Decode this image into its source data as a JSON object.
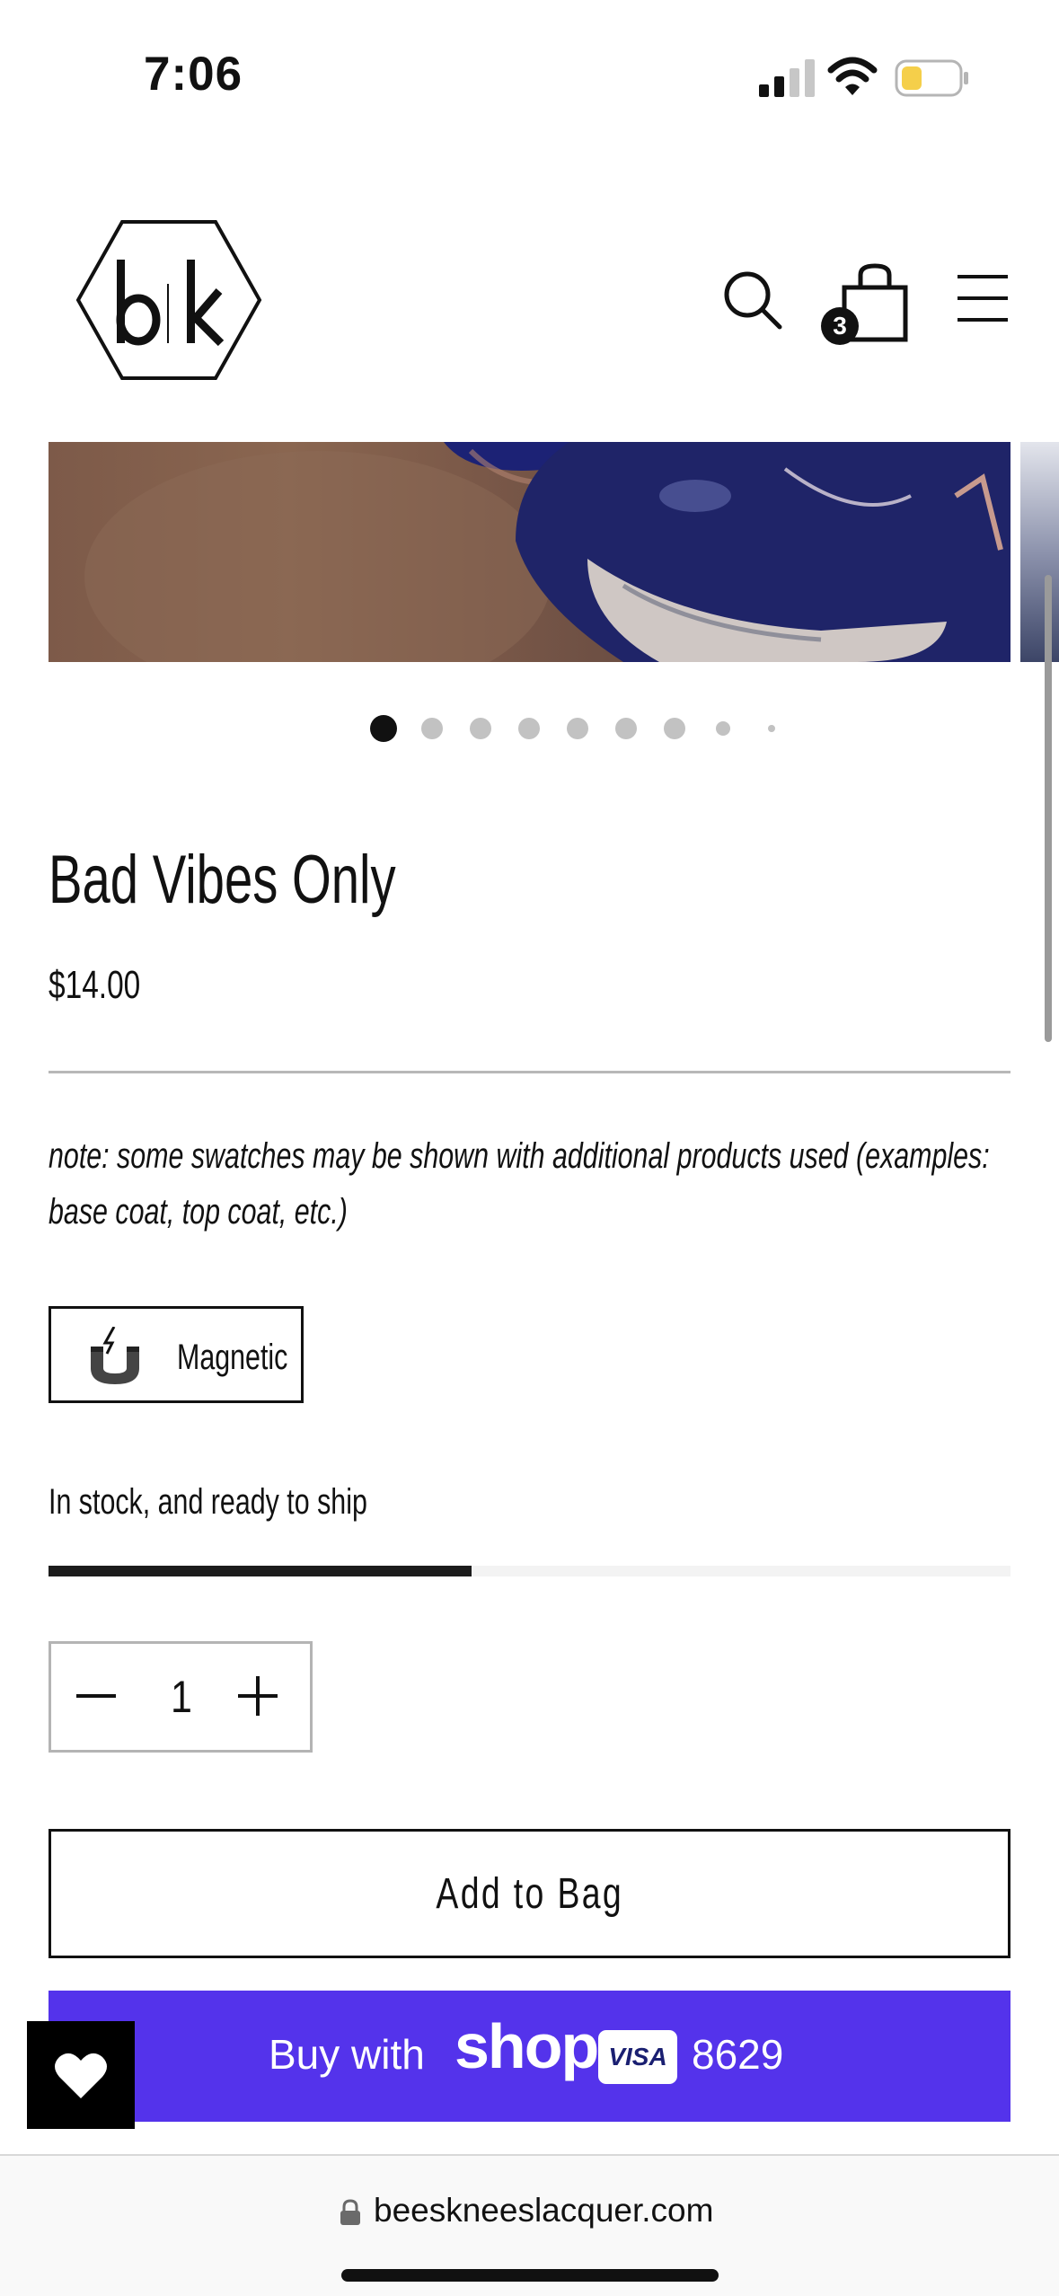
{
  "status_bar": {
    "time": "7:06",
    "icons": [
      "cellular-signal-icon",
      "wifi-icon",
      "battery-low-power-icon"
    ],
    "battery_color": "#f5cf4a"
  },
  "header": {
    "logo_text": "b|k",
    "icons": [
      "search-icon",
      "shopping-bag-icon",
      "hamburger-menu-icon"
    ],
    "cart_count": "3"
  },
  "gallery": {
    "slide_count": 9,
    "active_index": 0
  },
  "product": {
    "title": "Bad Vibes Only",
    "price": "$14.00",
    "note": "note: some swatches may be shown with additional products used (examples: base coat, top coat, etc.)",
    "badge_label": "Magnetic",
    "badge_icon": "magnet-icon",
    "stock_text": "In stock, and ready to ship",
    "stock_level": 0.44
  },
  "quantity": {
    "value": "1",
    "icons": [
      "minus-icon",
      "plus-icon"
    ]
  },
  "actions": {
    "add_to_bag": "Add to Bag",
    "shop_pay_prefix": "Buy with",
    "shop_pay_brand": "shop",
    "card_brand": "VISA",
    "card_last4": "8629",
    "shop_pay_color": "#5433eb"
  },
  "wishlist": {
    "icon": "heart-icon"
  },
  "browser": {
    "url": "beesknееslacquer.com"
  }
}
